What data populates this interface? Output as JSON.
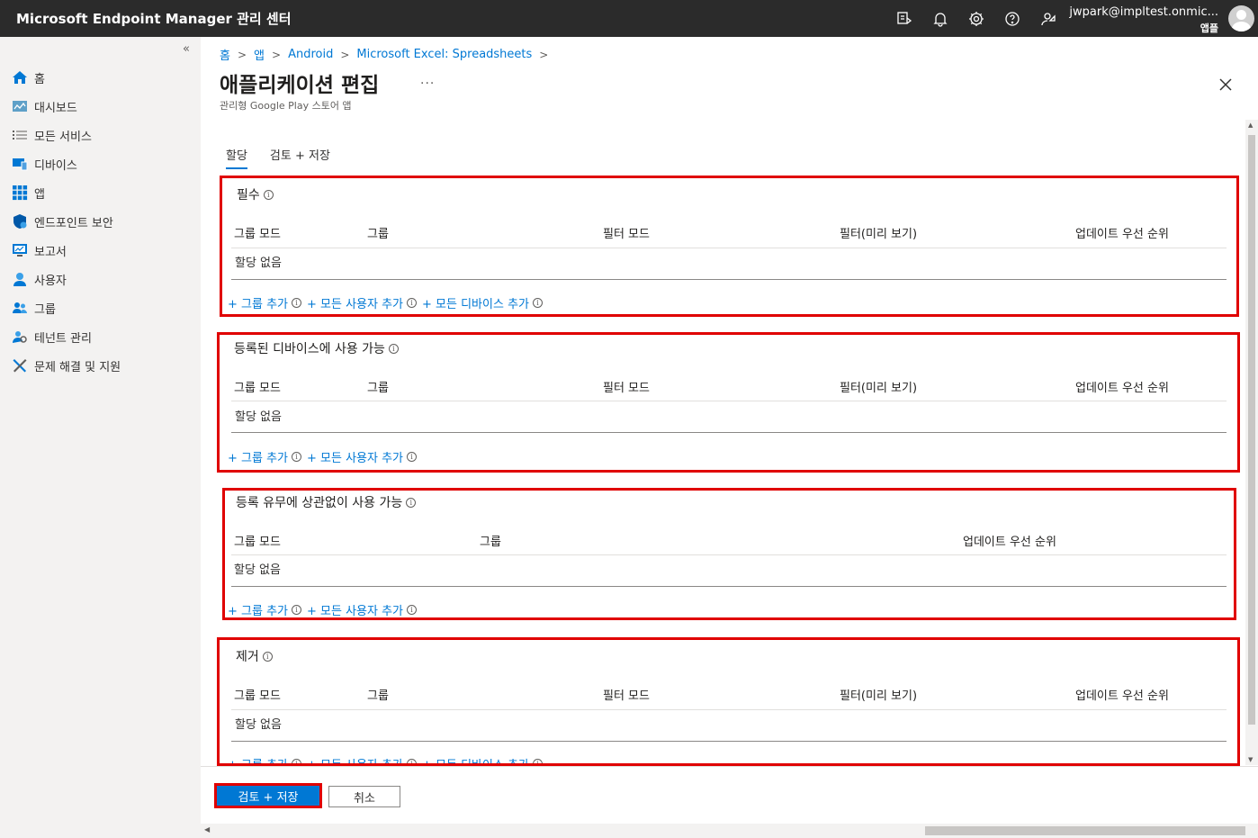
{
  "app": {
    "title": "Microsoft Endpoint Manager 관리 센터"
  },
  "header": {
    "icons": [
      "feedback-icon",
      "bell-icon",
      "gear-icon",
      "help-icon",
      "support-icon"
    ],
    "account_email": "jwpark@impltest.onmic...",
    "account_org": "앱플"
  },
  "sidebar": {
    "collapse_glyph": "«",
    "items": [
      {
        "label": "홈",
        "icon": "home-icon"
      },
      {
        "label": "대시보드",
        "icon": "dashboard-icon"
      },
      {
        "label": "모든 서비스",
        "icon": "list-icon"
      },
      {
        "label": "디바이스",
        "icon": "devices-icon"
      },
      {
        "label": "앱",
        "icon": "apps-icon"
      },
      {
        "label": "엔드포인트 보안",
        "icon": "shield-icon"
      },
      {
        "label": "보고서",
        "icon": "reports-icon"
      },
      {
        "label": "사용자",
        "icon": "user-icon"
      },
      {
        "label": "그룹",
        "icon": "group-icon"
      },
      {
        "label": "테넌트 관리",
        "icon": "tenant-icon"
      },
      {
        "label": "문제 해결 및 지원",
        "icon": "tools-icon"
      }
    ]
  },
  "breadcrumb": [
    "홈",
    "앱",
    "Android",
    "Microsoft Excel: Spreadsheets"
  ],
  "page": {
    "title": "애플리케이션 편집",
    "more": "...",
    "subtitle": "관리형 Google Play 스토어 앱"
  },
  "tabs": [
    "할당",
    "검토 + 저장"
  ],
  "sections": [
    {
      "title": "필수",
      "headers": [
        "그룹 모드",
        "그룹",
        "필터 모드",
        "필터(미리 보기)",
        "업데이트 우선 순위"
      ],
      "empty": "할당 없음",
      "links": [
        "+ 그룹 추가",
        "+ 모든 사용자 추가",
        "+ 모든 디바이스 추가"
      ]
    },
    {
      "title": "등록된 디바이스에 사용 가능",
      "headers": [
        "그룹 모드",
        "그룹",
        "필터 모드",
        "필터(미리 보기)",
        "업데이트 우선 순위"
      ],
      "empty": "할당 없음",
      "links": [
        "+ 그룹 추가",
        "+ 모든 사용자 추가"
      ]
    },
    {
      "title": "등록 유무에 상관없이 사용 가능",
      "headers": [
        "그룹 모드",
        "그룹",
        "업데이트 우선 순위"
      ],
      "empty": "할당 없음",
      "links": [
        "+ 그룹 추가",
        "+ 모든 사용자 추가"
      ]
    },
    {
      "title": "제거",
      "headers": [
        "그룹 모드",
        "그룹",
        "필터 모드",
        "필터(미리 보기)",
        "업데이트 우선 순위"
      ],
      "empty": "할당 없음",
      "links": [
        "+ 그룹 추가",
        "+ 모든 사용자 추가",
        "+ 모든 디바이스 추가"
      ]
    }
  ],
  "footer": {
    "primary": "검토 + 저장",
    "secondary": "취소"
  },
  "colors": {
    "accent": "#0078d4",
    "highlight": "#e00000",
    "topbar": "#2b2b2b",
    "sidebar": "#f3f2f1"
  }
}
